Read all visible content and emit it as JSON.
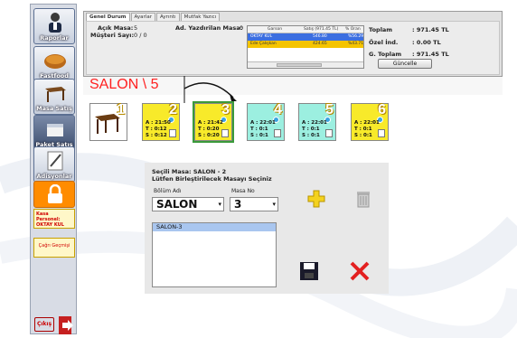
{
  "sidebar": {
    "items": [
      {
        "label": "Raporlar",
        "icon": "waiter-icon"
      },
      {
        "label": "Fastfood",
        "icon": "bread-icon"
      },
      {
        "label": "Masa Satış",
        "icon": "table-icon"
      },
      {
        "label": "Paket Satış",
        "icon": "package-icon"
      },
      {
        "label": "Adisyonlar",
        "icon": "pen-icon"
      }
    ],
    "kasa_label": "Kasa Personel:",
    "kasa_user": "OKTAY KUL",
    "cagri_label": "Çağrı Geçmişi",
    "cikis_label": "Çıkış"
  },
  "tabs": [
    "Genel Durum",
    "Ayarlar",
    "Ayrıntı",
    "Mutfak Yazıcı"
  ],
  "summary": {
    "acik_masa_label": "Açık Masa:",
    "acik_masa_value": "5",
    "musteri_label": "Müşteri Sayı:",
    "musteri_value": "0 / 0",
    "ad_yazdirilan_label": "Ad. Yazdırilan Masa:",
    "ad_yazdirilan_value": "0",
    "toplam_label": "Toplam",
    "toplam_value": ": 971.45 TL",
    "ozel_label": "Özel İnd.",
    "ozel_value": ": 0.00 TL",
    "g_toplam_label": "G. Toplam",
    "g_toplam_value": ": 971.45 TL",
    "guncelle_label": "Güncelle"
  },
  "staff_grid": {
    "headers": [
      "Garson",
      "Satış (971.45 TL)",
      "% Oran"
    ],
    "rows": [
      {
        "name": "OKTAY KUL",
        "sales": "546.80",
        "ratio": "%56.29"
      },
      {
        "name": "Ede Çalışkan",
        "sales": "424.65",
        "ratio": "%43.71"
      }
    ]
  },
  "salon_title": "SALON \\ 5",
  "tables": [
    {
      "num": "1",
      "color": "white",
      "a": "",
      "t": "",
      "s": ""
    },
    {
      "num": "2",
      "color": "yellow",
      "a": "A : 21:50",
      "t": "T : 0:12",
      "s": "S : 0:12"
    },
    {
      "num": "3",
      "color": "yellow",
      "a": "A : 21:42",
      "t": "T : 0:20",
      "s": "S : 0:20"
    },
    {
      "num": "4",
      "color": "cyan",
      "a": "A : 22:01",
      "t": "T : 0:1",
      "s": "S : 0:1"
    },
    {
      "num": "5",
      "color": "cyan",
      "a": "A : 22:01",
      "t": "T : 0:1",
      "s": "S : 0:1"
    },
    {
      "num": "6",
      "color": "yellow",
      "a": "A : 22:01",
      "t": "T : 0:1",
      "s": "S : 0:1"
    }
  ],
  "dialog": {
    "selected_label": "Seçili Masa: SALON - 2",
    "instruction": "Lütfen Birleştirilecek Masayı Seçiniz",
    "bolum_label": "Bölüm Adı",
    "masa_label": "Masa No",
    "bolum_value": "SALON",
    "masa_value": "3",
    "list_items": [
      "SALON-3"
    ]
  },
  "colors": {
    "accent_red": "#ff2020",
    "table_yellow": "#f8ea2a",
    "table_cyan": "#9cefe0",
    "grid_highlight": "#3b6ee0"
  }
}
